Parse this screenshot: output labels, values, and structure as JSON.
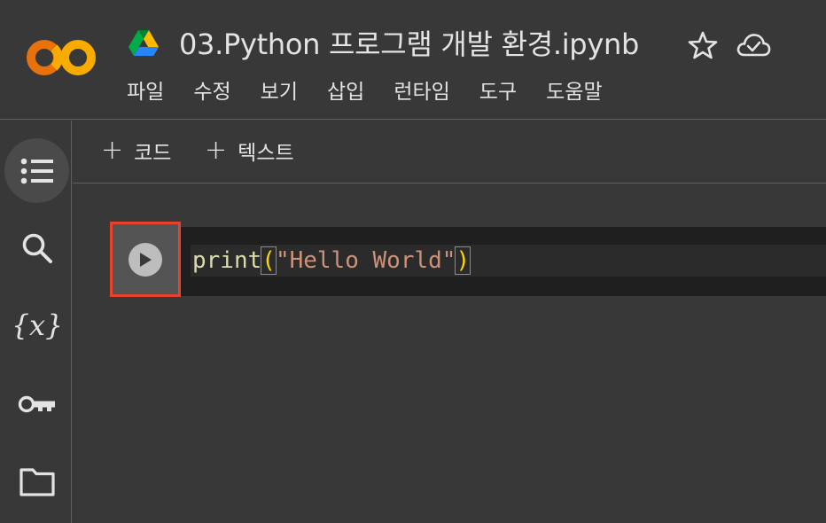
{
  "header": {
    "title": "03.Python 프로그램 개발 환경.ipynb",
    "logo_icon": "colab-logo-icon",
    "drive_icon": "google-drive-icon",
    "star_icon": "star-icon",
    "cloud_icon": "cloud-saved-icon"
  },
  "menu": {
    "items": [
      "파일",
      "수정",
      "보기",
      "삽입",
      "런타임",
      "도구",
      "도움말"
    ]
  },
  "toolbar": {
    "add_code_label": "코드",
    "add_text_label": "텍스트",
    "plus_glyph": "+"
  },
  "sidebar": {
    "items": [
      "toc-icon",
      "search-icon",
      "variables-icon",
      "key-icon",
      "folder-icon"
    ]
  },
  "cell": {
    "func": "print",
    "open_paren": "(",
    "string": "\"Hello World\"",
    "close_paren": ")",
    "run_icon": "play-icon"
  },
  "colors": {
    "background": "#383838",
    "cell_background": "#1f1f1f",
    "highlight_border": "#e8412c",
    "logo_orange": "#f9ab00",
    "logo_dark_orange": "#e8710a"
  }
}
